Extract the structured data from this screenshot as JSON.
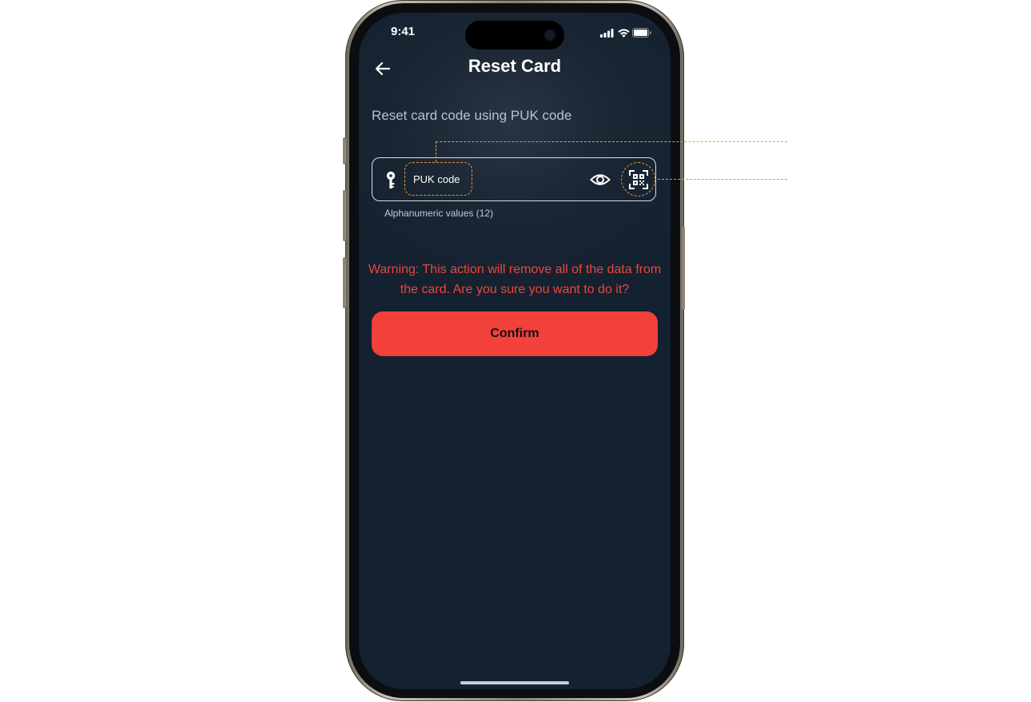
{
  "status_bar": {
    "time": "9:41"
  },
  "header": {
    "title": "Reset Card",
    "back_icon": "arrow-left-icon"
  },
  "subtitle": "Reset card code using PUK code",
  "puk_field": {
    "placeholder": "PUK code",
    "value": "",
    "helper": "Alphanumeric values (12)",
    "leading_icon": "key-icon",
    "visibility_icon": "eye-icon",
    "scan_icon": "qr-scan-icon"
  },
  "warning": "Warning: This action will remove all of the data from the card. Are you sure you want to do it?",
  "confirm_label": "Confirm",
  "colors": {
    "accent": "#f2413a",
    "warning_text": "#f0453a",
    "annotation": "#e89a3a",
    "background": "#142130"
  }
}
